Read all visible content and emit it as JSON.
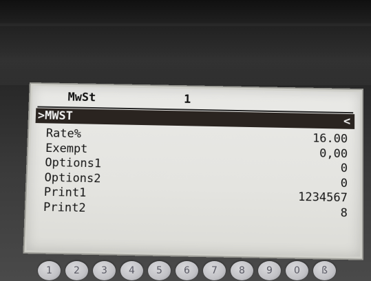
{
  "screen": {
    "title": "MwSt",
    "title_value": "1",
    "selected_item": ">MWST",
    "selected_marker": "<",
    "rows": [
      {
        "label": "Rate%",
        "value": "16.00"
      },
      {
        "label": "Exempt",
        "value": "0,00"
      },
      {
        "label": "Options1",
        "value": "0"
      },
      {
        "label": "Options2",
        "value": "0"
      },
      {
        "label": "Print1",
        "value": "1234567"
      },
      {
        "label": "Print2",
        "value": "8"
      }
    ]
  },
  "keypad": {
    "keys": [
      "1",
      "2",
      "3",
      "4",
      "5",
      "6",
      "7",
      "8",
      "9",
      "0",
      "ß"
    ]
  }
}
